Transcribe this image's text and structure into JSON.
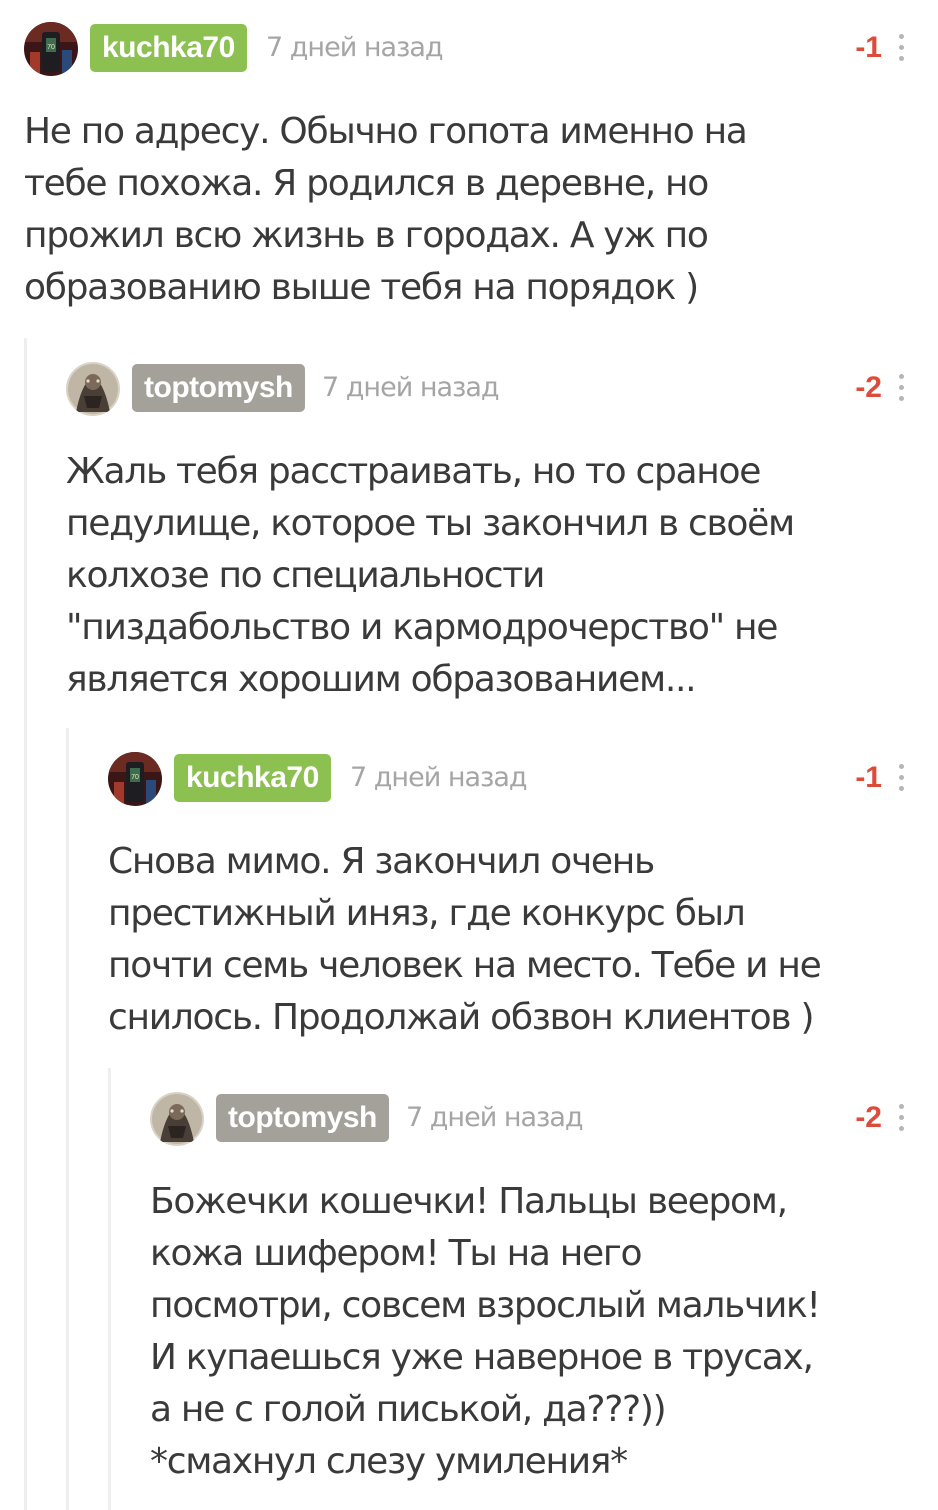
{
  "colors": {
    "username_green": "#8cc152",
    "username_gray": "#a4a19b",
    "rating_negative": "#dd4b3a",
    "timestamp": "#a5a5a5",
    "thread_line": "#eeeeee"
  },
  "comments": [
    {
      "username": "kuchka70",
      "avatar_icon": "avatar-kuchka70-icon",
      "time": "7 дней назад",
      "rating": "-1",
      "text": "Не по адресу. Обычно гопота именно на\nтебе похожа. Я родился в деревне, но\nпрожил всю жизнь в городах. А уж по\nобразованию выше тебя на порядок )"
    },
    {
      "username": "toptomysh",
      "avatar_icon": "avatar-toptomysh-icon",
      "time": "7 дней назад",
      "rating": "-2",
      "text": "Жаль тебя расстраивать, но то сраное\nпедулище, которое ты закончил в своём\nколхозе по специальности\n\"пиздабольство и кармодрочерство\" не\nявляется хорошим образованием..."
    },
    {
      "username": "kuchka70",
      "avatar_icon": "avatar-kuchka70-icon",
      "time": "7 дней назад",
      "rating": "-1",
      "text": "Снова мимо. Я закончил очень\nпрестижный иняз, где конкурс был\nпочти семь человек на место. Тебе и не\nснилось. Продолжай обзвон клиентов )"
    },
    {
      "username": "toptomysh",
      "avatar_icon": "avatar-toptomysh-icon",
      "time": "7 дней назад",
      "rating": "-2",
      "text": "Божечки кошечки! Пальцы веером,\nкожа шифером! Ты на него\nпосмотри, совсем взрослый мальчик!\nИ купаешься уже наверное в трусах,\nа не с голой писькой, да???))\n*смахнул слезу умиления*"
    }
  ]
}
